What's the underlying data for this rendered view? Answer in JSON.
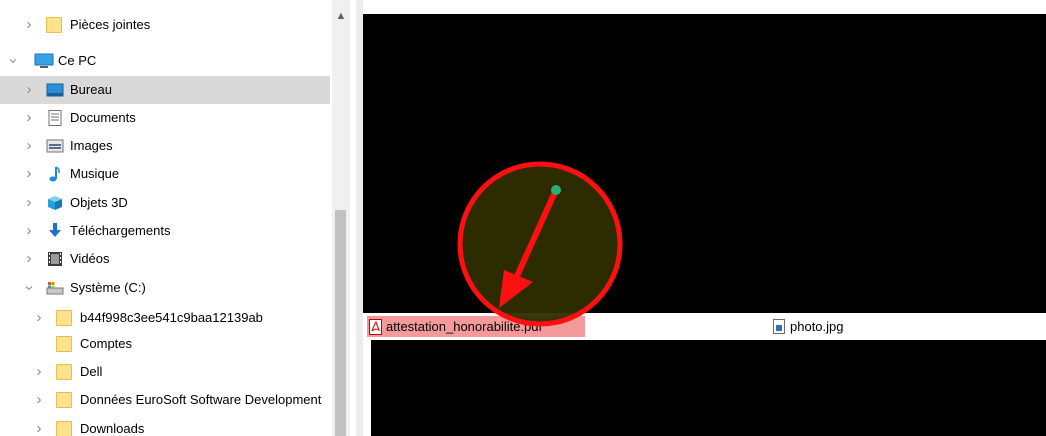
{
  "nav": {
    "items": [
      {
        "label": "Pièces jointes",
        "icon": "folder-icon",
        "expandable": true,
        "expanded": false,
        "indent": 1
      },
      {
        "label": "Ce PC",
        "icon": "computer-icon",
        "expandable": true,
        "expanded": true,
        "indent": 0
      },
      {
        "label": "Bureau",
        "icon": "desktop-icon",
        "expandable": true,
        "expanded": false,
        "indent": 1,
        "selected": true
      },
      {
        "label": "Documents",
        "icon": "documents-icon",
        "expandable": true,
        "expanded": false,
        "indent": 1
      },
      {
        "label": "Images",
        "icon": "pictures-icon",
        "expandable": true,
        "expanded": false,
        "indent": 1
      },
      {
        "label": "Musique",
        "icon": "music-icon",
        "expandable": true,
        "expanded": false,
        "indent": 1
      },
      {
        "label": "Objets 3D",
        "icon": "objects-3d-icon",
        "expandable": true,
        "expanded": false,
        "indent": 1
      },
      {
        "label": "Téléchargements",
        "icon": "downloads-icon",
        "expandable": true,
        "expanded": false,
        "indent": 1
      },
      {
        "label": "Vidéos",
        "icon": "videos-icon",
        "expandable": true,
        "expanded": false,
        "indent": 1
      },
      {
        "label": "Système (C:)",
        "icon": "drive-icon",
        "expandable": true,
        "expanded": true,
        "indent": 1
      },
      {
        "label": "b44f998c3ee541c9baa12139ab",
        "icon": "folder-icon",
        "expandable": true,
        "expanded": false,
        "indent": 2
      },
      {
        "label": "Comptes",
        "icon": "folder-icon",
        "expandable": false,
        "expanded": false,
        "indent": 2
      },
      {
        "label": "Dell",
        "icon": "folder-icon",
        "expandable": true,
        "expanded": false,
        "indent": 2
      },
      {
        "label": "Données EuroSoft Software Development",
        "icon": "folder-icon",
        "expandable": true,
        "expanded": false,
        "indent": 2
      },
      {
        "label": "Downloads",
        "icon": "folder-icon",
        "expandable": true,
        "expanded": false,
        "indent": 2
      }
    ]
  },
  "content": {
    "files": [
      {
        "name": "attestation_honorabilite.pdf",
        "icon": "pdf-icon",
        "highlighted": true
      },
      {
        "name": "photo.jpg",
        "icon": "image-file-icon",
        "highlighted": false
      }
    ],
    "annotation": {
      "circle_color": "#ff0000",
      "arrow_color": "#ff0000",
      "tip_color": "#27b07a"
    }
  },
  "colors": {
    "selected_bg": "#d9d9d9",
    "highlight_bg": "#f59a9a",
    "folder": "#ffe38c"
  }
}
